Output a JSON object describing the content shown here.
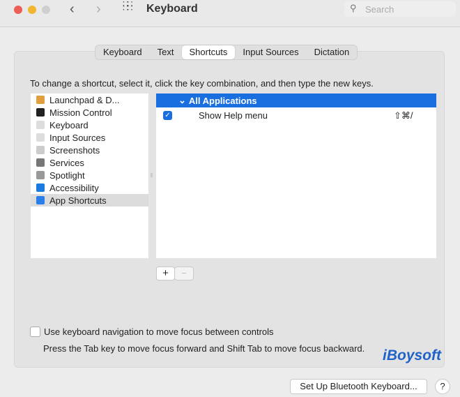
{
  "window": {
    "title": "Keyboard",
    "search_placeholder": "Search"
  },
  "tabs": [
    {
      "label": "Keyboard"
    },
    {
      "label": "Text"
    },
    {
      "label": "Shortcuts",
      "active": true
    },
    {
      "label": "Input Sources"
    },
    {
      "label": "Dictation"
    }
  ],
  "instruction": "To change a shortcut, select it, click the key combination, and then type the new keys.",
  "categories": [
    {
      "label": "Launchpad & D...",
      "icon": "launchpad-icon",
      "color": "#e0a040"
    },
    {
      "label": "Mission Control",
      "icon": "mission-control-icon",
      "color": "#222222"
    },
    {
      "label": "Keyboard",
      "icon": "keyboard-icon",
      "color": "#dddddd"
    },
    {
      "label": "Input Sources",
      "icon": "keyboard-icon",
      "color": "#dddddd"
    },
    {
      "label": "Screenshots",
      "icon": "screenshot-icon",
      "color": "#cccccc"
    },
    {
      "label": "Services",
      "icon": "gear-icon",
      "color": "#777777"
    },
    {
      "label": "Spotlight",
      "icon": "magnifier-icon",
      "color": "#999999"
    },
    {
      "label": "Accessibility",
      "icon": "accessibility-icon",
      "color": "#1a7ae0"
    },
    {
      "label": "App Shortcuts",
      "icon": "app-store-icon",
      "color": "#2a80e8",
      "selected": true
    }
  ],
  "shortcuts": {
    "group": "All Applications",
    "items": [
      {
        "label": "Show Help menu",
        "keys": "⇧⌘/",
        "checked": true
      }
    ]
  },
  "add_label": "+",
  "remove_label": "−",
  "keyboard_nav": {
    "label": "Use keyboard navigation to move focus between controls",
    "checked": false,
    "hint": "Press the Tab key to move focus forward and Shift Tab to move focus backward."
  },
  "bluetooth_button": "Set Up Bluetooth Keyboard...",
  "help_label": "?",
  "watermark": "iBoysoft",
  "accent": "#1a6fe0"
}
